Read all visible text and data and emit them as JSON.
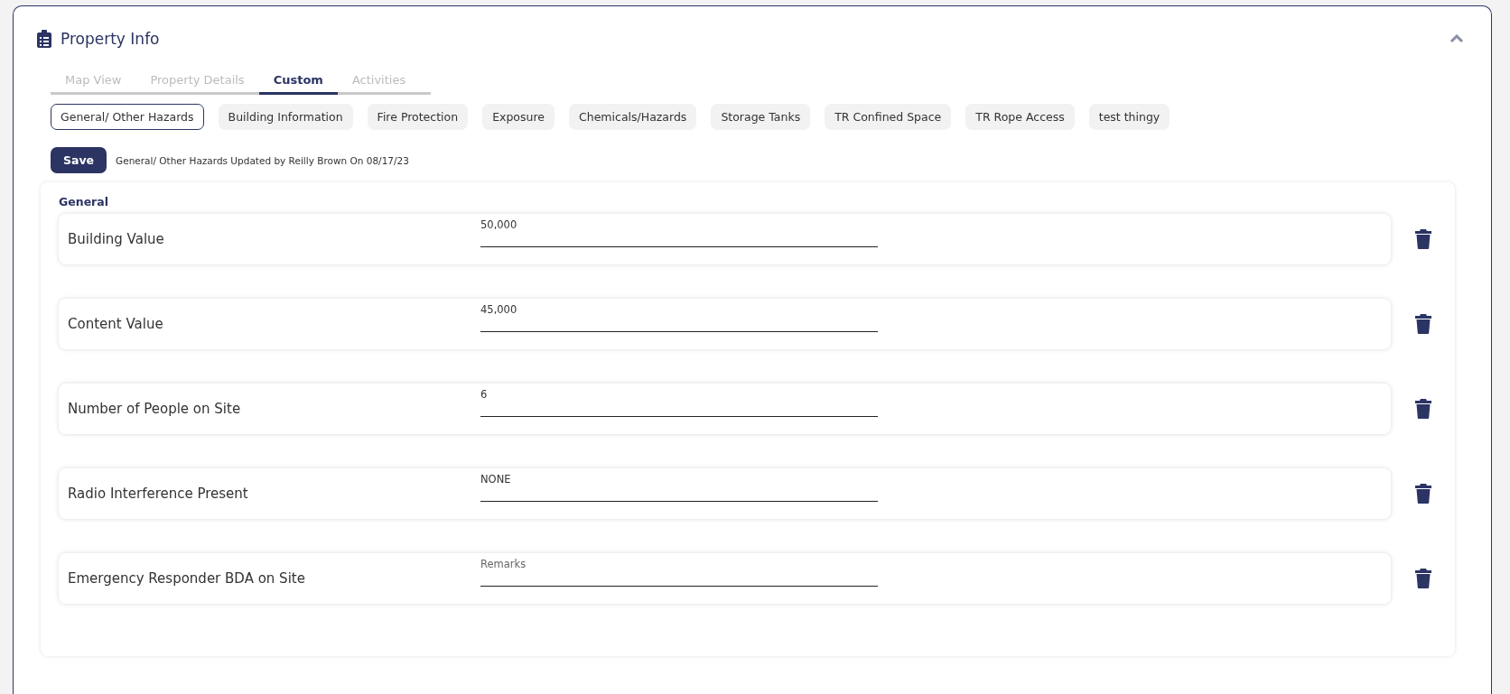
{
  "panel": {
    "title": "Property Info",
    "expanded": true
  },
  "tabs": [
    {
      "label": "Map View",
      "selected": false
    },
    {
      "label": "Property Details",
      "selected": false
    },
    {
      "label": "Custom",
      "selected": true
    },
    {
      "label": "Activities",
      "selected": false
    }
  ],
  "sections": [
    {
      "label": "General/ Other Hazards",
      "selected": true
    },
    {
      "label": "Building Information",
      "selected": false
    },
    {
      "label": "Fire Protection",
      "selected": false
    },
    {
      "label": "Exposure",
      "selected": false
    },
    {
      "label": "Chemicals/Hazards",
      "selected": false
    },
    {
      "label": "Storage Tanks",
      "selected": false
    },
    {
      "label": "TR Confined Space",
      "selected": false
    },
    {
      "label": "TR Rope Access",
      "selected": false
    },
    {
      "label": "test thingy",
      "selected": false
    }
  ],
  "save_button": "Save",
  "update_note": "General/ Other Hazards Updated by Reilly Brown On 08/17/23",
  "group": {
    "title": "General",
    "fields": [
      {
        "label": "Building Value",
        "value": "50,000"
      },
      {
        "label": "Content Value",
        "value": "45,000"
      },
      {
        "label": "Number of People on Site",
        "value": "6"
      },
      {
        "label": "Radio Interference Present",
        "value": "NONE"
      },
      {
        "label": "Emergency Responder BDA on Site",
        "placeholder": "Remarks"
      }
    ]
  }
}
